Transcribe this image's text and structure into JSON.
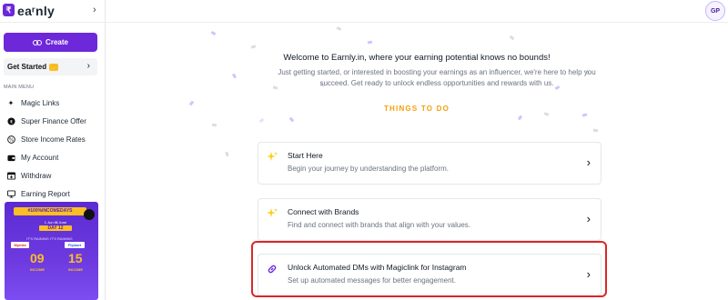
{
  "sidebar": {
    "logo_text": "eaʳnly",
    "logo_glyph": "₹",
    "collapse_icon": "chevron-right",
    "create_label": "Create",
    "get_started_label": "Get Started",
    "get_started_badge": "👋",
    "menu_heading": "MAIN MENU",
    "items": [
      {
        "label": "Magic Links",
        "icon": "sparkles-icon"
      },
      {
        "label": "Super Finance Offer",
        "icon": "rupee-circle-icon"
      },
      {
        "label": "Store Income Rates",
        "icon": "percent-icon"
      },
      {
        "label": "My Account",
        "icon": "wallet-icon"
      },
      {
        "label": "Withdraw",
        "icon": "withdraw-icon"
      },
      {
        "label": "Earning Report",
        "icon": "report-icon"
      }
    ],
    "promo": {
      "tag": "#100%INCOMEDAYS",
      "date_range": "1 Jun till June",
      "day": "DAY 12",
      "sub": "IT'S RAINING IT'S RAINING",
      "brand1": "Myntra",
      "brand2": "Flipkart",
      "value1": "09",
      "value2": "15",
      "label1": "INCOME",
      "label2": "INCOME"
    }
  },
  "topbar": {
    "avatar_initials": "GP"
  },
  "main": {
    "welcome_title": "Welcome to Earnly.in, where your earning potential knows no bounds!",
    "welcome_sub": "Just getting started, or interested in boosting your earnings as an influencer, we're here to help you succeed. Get ready to unlock endless opportunities and rewards with us.",
    "things_heading": "THINGS TO DO",
    "cards": [
      {
        "title": "Start Here",
        "desc": "Begin your journey by understanding the platform.",
        "icon": "sparkle-icon"
      },
      {
        "title": "Connect with Brands",
        "desc": "Find and connect with brands that align with your values.",
        "icon": "sparkle-icon"
      },
      {
        "title": "Unlock Automated DMs with Magiclink for Instagram",
        "desc": "Set up automated messages for better engagement.",
        "icon": "link-icon"
      }
    ]
  },
  "colors": {
    "brand": "#6d28d9",
    "accent": "#f59e0b",
    "highlight": "#dc2626"
  }
}
